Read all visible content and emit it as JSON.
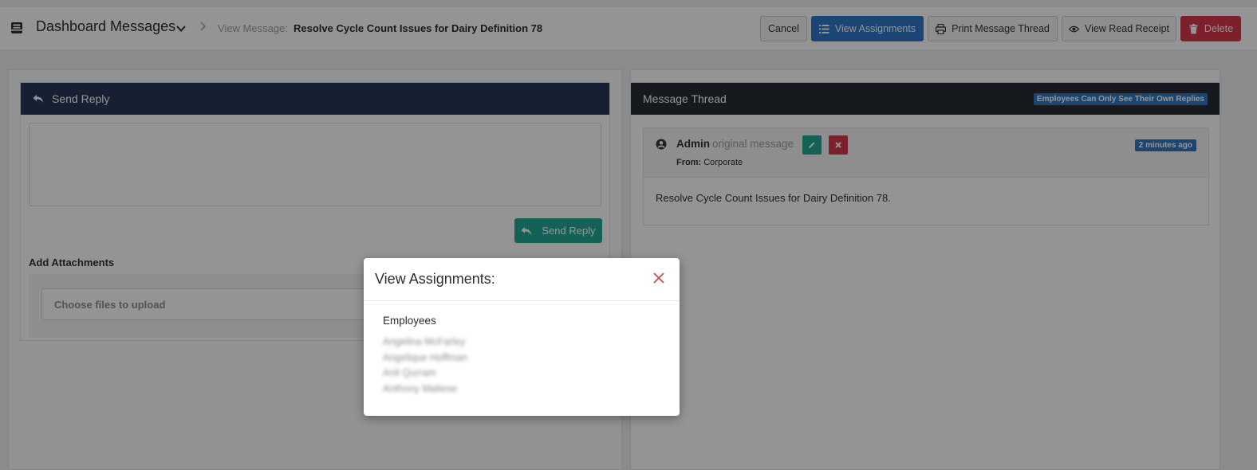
{
  "header": {
    "title": "Dashboard Messages",
    "title_icon": "inbox-icon",
    "breadcrumb_label": "View Message:",
    "breadcrumb_value": "Resolve Cycle Count Issues for Dairy Definition 78",
    "buttons": {
      "cancel": "Cancel",
      "view_assignments": "View Assignments",
      "print_thread": "Print Message Thread",
      "view_read_receipt": "View Read Receipt",
      "delete": "Delete"
    }
  },
  "reply": {
    "header": "Send Reply",
    "reply_text": "",
    "send_label": "Send Reply",
    "attachments_label": "Add Attachments",
    "upload_placeholder": "Choose files to upload"
  },
  "thread": {
    "header": "Message Thread",
    "notice": "Employees Can Only See Their Own Replies",
    "message": {
      "author": "Admin",
      "kind": "original message",
      "from_label": "From:",
      "from_value": "Corporate",
      "time": "2 minutes ago",
      "body": "Resolve Cycle Count Issues for Dairy Definition 78."
    }
  },
  "modal": {
    "title": "View Assignments:",
    "section": "Employees",
    "employees": [
      "Angelina McFarley",
      "Angelique Hoffman",
      "Anil Qurram",
      "Anthony Maltese"
    ]
  },
  "colors": {
    "primary": "#2f78c4",
    "danger": "#d6374a",
    "success": "#24a898",
    "navy": "#263757",
    "dark": "#262b32"
  }
}
